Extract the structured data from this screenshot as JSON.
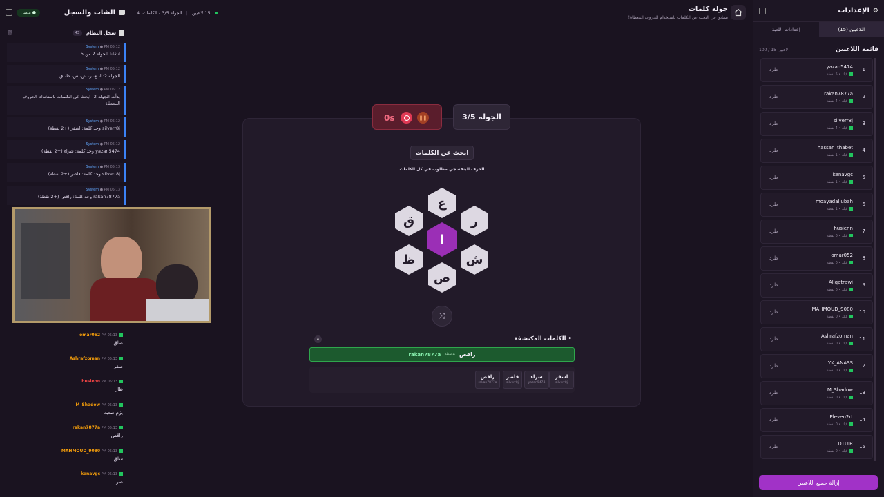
{
  "right_panel": {
    "title": "الإعدادات",
    "tab_players": "اللاعبين (15)",
    "tab_game_settings": "إعدادات اللعبة",
    "list_title": "قائمة اللاعبين",
    "count": "100 / 15 لاعبين",
    "kick": "طرد",
    "remove_all": "إزالة جميع اللاعبين",
    "players": [
      {
        "rank": "1",
        "name": "yazan5474",
        "score": "5 نقطة"
      },
      {
        "rank": "2",
        "name": "rakan7877a",
        "score": "4 نقطة"
      },
      {
        "rank": "3",
        "name": "silverr8j",
        "score": "4 نقطة"
      },
      {
        "rank": "4",
        "name": "hassan_thabet",
        "score": "1 نقطة"
      },
      {
        "rank": "5",
        "name": "kenavgc",
        "score": "1 نقطة"
      },
      {
        "rank": "6",
        "name": "moayadaljubah",
        "score": "1 نقطة"
      },
      {
        "rank": "7",
        "name": "husienn",
        "score": "0 نقطة"
      },
      {
        "rank": "8",
        "name": "omar052",
        "score": "0 نقطة"
      },
      {
        "rank": "9",
        "name": "Aliqatrawi",
        "score": "0 نقطة"
      },
      {
        "rank": "10",
        "name": "MAHMOUD_9080",
        "score": "0 نقطة"
      },
      {
        "rank": "11",
        "name": "Ashrafzoman",
        "score": "0 نقطة"
      },
      {
        "rank": "12",
        "name": "YK_ANASS",
        "score": "0 نقطة"
      },
      {
        "rank": "13",
        "name": "M_Shadow",
        "score": "0 نقطة"
      },
      {
        "rank": "14",
        "name": "Eleven2rt",
        "score": "0 نقطة"
      },
      {
        "rank": "15",
        "name": "DTUIR",
        "score": "0 نقطة"
      }
    ],
    "score_prefix": "كيك •"
  },
  "left_panel": {
    "title": "الشات والسجل",
    "status": "متصل",
    "system_log": "سجل النظام",
    "system_count": "43",
    "system_messages": [
      {
        "time": "PM 05:12",
        "sender": "System",
        "text": "انتقلنا للجوله 2 من 5"
      },
      {
        "time": "PM 05:12",
        "sender": "System",
        "text": "الجوله 2: ا، ع، ر، ش، ص، ظ، ق"
      },
      {
        "time": "PM 05:12",
        "sender": "System",
        "text": "بدأت الجوله 2! ابحث عن الكلمات باستخدام الحروف المعطاة"
      },
      {
        "time": "PM 05:12",
        "sender": "System",
        "text": "silverr8j وجد كلمة: اشقر (+2 نقطة)"
      },
      {
        "time": "PM 05:12",
        "sender": "System",
        "text": "yazan5474 وجد كلمة: شراء (+2 نقطة)"
      },
      {
        "time": "PM 05:13",
        "sender": "System",
        "text": "silverr8j وجد كلمة: قاصر (+2 نقطة)"
      },
      {
        "time": "PM 05:13",
        "sender": "System",
        "text": "rakan7877a وجد كلمة: راقص (+2 نقطة)"
      }
    ],
    "chat_messages": [
      {
        "time": "PM 05:13",
        "user": "omar052",
        "color": "#f59e0b",
        "text": "صاق"
      },
      {
        "time": "PM 05:13",
        "user": "Ashrafzoman",
        "color": "#f59e0b",
        "text": "صقر"
      },
      {
        "time": "PM 05:13",
        "user": "husienn",
        "color": "#ef4444",
        "text": "ظار"
      },
      {
        "time": "PM 05:13",
        "user": "M_Shadow",
        "color": "#f59e0b",
        "text": "يزم صعبه"
      },
      {
        "time": "PM 05:13",
        "user": "rakan7877a",
        "color": "#f59e0b",
        "text": "راقص"
      },
      {
        "time": "PM 05:13",
        "user": "MAHMOUD_9080",
        "color": "#f59e0b",
        "text": "شاق"
      },
      {
        "time": "PM 05:13",
        "user": "kenavgc",
        "color": "#f59e0b",
        "text": "صر"
      }
    ]
  },
  "top_bar": {
    "title": "جوله كلمات",
    "subtitle": "تسابق في البحث عن الكلمات باستخدام الحروف المعطاة!",
    "round_info": "الجوله 3/5 - الكلمات: 4",
    "players": "15 لاعبين"
  },
  "game": {
    "round_label": "الجوله 3/5",
    "timer": "0s",
    "heading": "ابحث عن الكلمات",
    "hint": "الحرف البنفسجي مطلوب في كل الكلمات",
    "letters": {
      "center": "ا",
      "top": "ع",
      "top_right": "ر",
      "bottom_right": "ش",
      "bottom": "ص",
      "bottom_left": "ظ",
      "top_left": "ق"
    },
    "found_title": "الكلمات المكتشفة",
    "found_count": "4",
    "latest_word": "راقص",
    "latest_by": "rakan7877a",
    "latest_sep": "بواسطة",
    "words": [
      {
        "word": "اشقر",
        "user": "silverr8j"
      },
      {
        "word": "شراء",
        "user": "yazan5474"
      },
      {
        "word": "قاصر",
        "user": "silverr8j"
      },
      {
        "word": "راقص",
        "user": "rakan7877a"
      }
    ]
  },
  "colors": {
    "accent": "#9b2fb6",
    "success": "#22c55e",
    "bg": "#1a1320"
  }
}
